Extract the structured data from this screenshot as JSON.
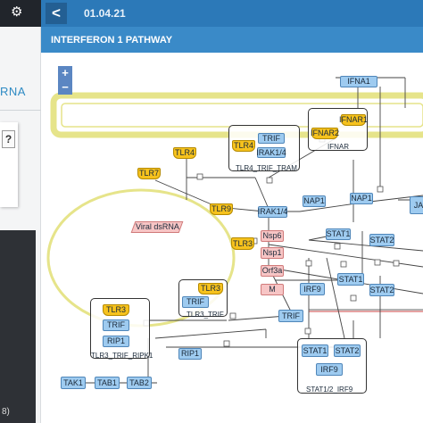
{
  "sidebar": {
    "partial_text": "RNA",
    "help_label": "?",
    "bottom_text": "8)"
  },
  "topbar": {
    "back_label": "<",
    "version": "01.04.21"
  },
  "pathway": {
    "title": "INTERFERON 1 PATHWAY"
  },
  "zoom": {
    "in": "+",
    "out": "−"
  },
  "complexes": {
    "tlr4_trif_tram": "TLR4_TRIF_TRAM",
    "ifnar": "IFNAR",
    "tlr3_trif": "TLR3_TRIF",
    "tlr3_trif_ripk1": "TLR3_TRIF_RIPK1",
    "stat12_irf9": "STAT1/2_IRF9"
  },
  "nodes": {
    "ifna1": "IFNA1",
    "ifnar1": "IFNAR1",
    "ifnar2": "IFNAR2",
    "tlr4": "TLR4",
    "trif_a": "TRIF",
    "irak14_in": "IRAK1/4",
    "tlr4_free": "TLR4",
    "tlr7": "TLR7",
    "tlr9": "TLR9",
    "irak14": "IRAK1/4",
    "nap1_a": "NAP1",
    "nap1_b": "NAP1",
    "ja": "JA",
    "viral_dsrna": "Viral dsRNA",
    "tlr3_free": "TLR3",
    "nsp6": "Nsp6",
    "nsp1": "Nsp1",
    "orf3a": "Orf3a",
    "m": "M",
    "stat1_a": "STAT1",
    "stat2_a": "STAT2",
    "stat1_b": "STAT1",
    "stat2_b": "STAT2",
    "irf9_a": "IRF9",
    "tlr3_c": "TLR3",
    "trif_c": "TRIF",
    "trif_d": "TRIF",
    "tlr3_k": "TLR3",
    "trif_k": "TRIF",
    "rip1_k": "RIP1",
    "rip1": "RIP1",
    "stat1_c": "STAT1",
    "stat2_c": "STAT2",
    "irf9_c": "IRF9",
    "tak1": "TAK1",
    "tab1": "TAB1",
    "tab2": "TAB2"
  },
  "colors": {
    "topbar": "#2c79b8",
    "titlebar": "#3a8ac8",
    "membrane": "#e6e48a",
    "protein": "#9ecbf0",
    "receptor": "#f6c21d",
    "inhibitor": "#f7c5c5"
  },
  "icons": [
    "chevron-left-icon",
    "edit-icon",
    "user-settings-icon",
    "zoom-in-icon",
    "zoom-out-icon"
  ]
}
